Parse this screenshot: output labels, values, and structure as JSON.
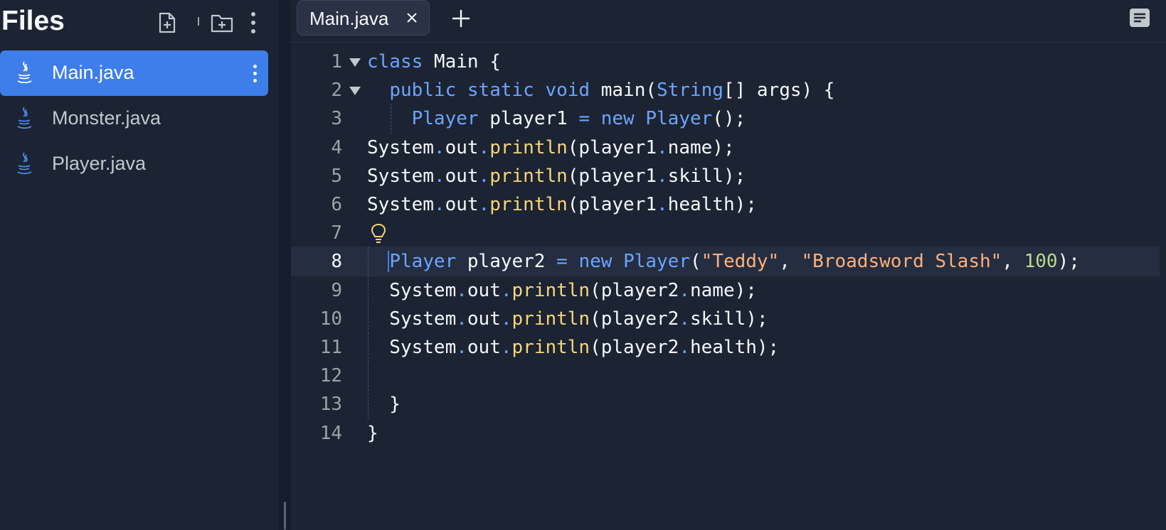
{
  "sidebar": {
    "title": "Files",
    "files": [
      {
        "name": "Main.java",
        "active": true
      },
      {
        "name": "Monster.java",
        "active": false
      },
      {
        "name": "Player.java",
        "active": false
      }
    ]
  },
  "tabs": [
    {
      "label": "Main.java",
      "active": true
    }
  ],
  "editor": {
    "current_line": 8,
    "lines": [
      {
        "n": "1",
        "tokens": [
          [
            "class",
            "k"
          ],
          [
            " Main {",
            ""
          ]
        ]
      },
      {
        "n": "2",
        "tokens": [
          [
            "  ",
            ""
          ],
          [
            "public static void",
            "k"
          ],
          [
            " main(",
            ""
          ],
          [
            "String",
            "k"
          ],
          [
            "[] args) {",
            ""
          ]
        ]
      },
      {
        "n": "3",
        "tokens": [
          [
            "    ",
            ""
          ],
          [
            "Player",
            "k"
          ],
          [
            " player1 ",
            ""
          ],
          [
            "=",
            "k"
          ],
          [
            " ",
            ""
          ],
          [
            "new",
            "k"
          ],
          [
            " ",
            ""
          ],
          [
            "Player",
            "k"
          ],
          [
            "();",
            ""
          ]
        ]
      },
      {
        "n": "4",
        "tokens": [
          [
            "System",
            ""
          ],
          [
            ".",
            "p"
          ],
          [
            "out",
            ""
          ],
          [
            ".",
            "p"
          ],
          [
            "println",
            "m"
          ],
          [
            "(player1",
            ""
          ],
          [
            ".",
            "p"
          ],
          [
            "name);",
            ""
          ]
        ]
      },
      {
        "n": "5",
        "tokens": [
          [
            "System",
            ""
          ],
          [
            ".",
            "p"
          ],
          [
            "out",
            ""
          ],
          [
            ".",
            "p"
          ],
          [
            "println",
            "m"
          ],
          [
            "(player1",
            ""
          ],
          [
            ".",
            "p"
          ],
          [
            "skill);",
            ""
          ]
        ]
      },
      {
        "n": "6",
        "tokens": [
          [
            "System",
            ""
          ],
          [
            ".",
            "p"
          ],
          [
            "out",
            ""
          ],
          [
            ".",
            "p"
          ],
          [
            "println",
            "m"
          ],
          [
            "(player1",
            ""
          ],
          [
            ".",
            "p"
          ],
          [
            "health);",
            ""
          ]
        ]
      },
      {
        "n": "7",
        "tokens": []
      },
      {
        "n": "8",
        "tokens": [
          [
            "  ",
            ""
          ],
          [
            "Player",
            "k"
          ],
          [
            " player2 ",
            ""
          ],
          [
            "=",
            "k"
          ],
          [
            " ",
            ""
          ],
          [
            "new",
            "k"
          ],
          [
            " ",
            ""
          ],
          [
            "Player",
            "k"
          ],
          [
            "(",
            ""
          ],
          [
            "\"Teddy\"",
            "s"
          ],
          [
            ", ",
            ""
          ],
          [
            "\"Broadsword Slash\"",
            "s"
          ],
          [
            ", ",
            ""
          ],
          [
            "100",
            "n"
          ],
          [
            ");",
            ""
          ]
        ]
      },
      {
        "n": "9",
        "tokens": [
          [
            "  System",
            ""
          ],
          [
            ".",
            "p"
          ],
          [
            "out",
            ""
          ],
          [
            ".",
            "p"
          ],
          [
            "println",
            "m"
          ],
          [
            "(player2",
            ""
          ],
          [
            ".",
            "p"
          ],
          [
            "name);",
            ""
          ]
        ]
      },
      {
        "n": "10",
        "tokens": [
          [
            "  System",
            ""
          ],
          [
            ".",
            "p"
          ],
          [
            "out",
            ""
          ],
          [
            ".",
            "p"
          ],
          [
            "println",
            "m"
          ],
          [
            "(player2",
            ""
          ],
          [
            ".",
            "p"
          ],
          [
            "skill);",
            ""
          ]
        ]
      },
      {
        "n": "11",
        "tokens": [
          [
            "  System",
            ""
          ],
          [
            ".",
            "p"
          ],
          [
            "out",
            ""
          ],
          [
            ".",
            "p"
          ],
          [
            "println",
            "m"
          ],
          [
            "(player2",
            ""
          ],
          [
            ".",
            "p"
          ],
          [
            "health);",
            ""
          ]
        ]
      },
      {
        "n": "12",
        "tokens": []
      },
      {
        "n": "13",
        "tokens": [
          [
            "  }",
            ""
          ]
        ]
      },
      {
        "n": "14",
        "tokens": [
          [
            "}",
            ""
          ]
        ]
      }
    ]
  },
  "colors": {
    "background": "#1c2333",
    "accent": "#3d7eea",
    "keyword": "#6ba5ff",
    "method": "#f5d679",
    "string": "#ffb07a",
    "number": "#b8dc8a"
  },
  "icons": {
    "new_file": "file-plus-icon",
    "new_folder": "folder-plus-icon",
    "more": "kebab-menu-icon",
    "java": "java-icon",
    "close": "close-icon",
    "add_tab": "plus-icon",
    "outline": "outline-icon",
    "lightbulb": "lightbulb-icon"
  }
}
